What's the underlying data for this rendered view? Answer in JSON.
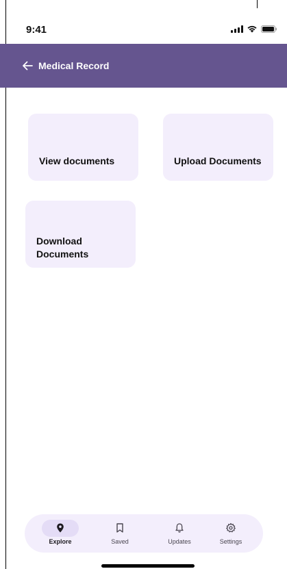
{
  "status_bar": {
    "time": "9:41"
  },
  "app_bar": {
    "title": "Medical Record"
  },
  "cards": [
    {
      "label": "View documents"
    },
    {
      "label": "Upload Documents"
    },
    {
      "label": "Download Documents"
    }
  ],
  "nav": [
    {
      "label": "Explore",
      "icon": "location-pin-icon",
      "active": true
    },
    {
      "label": "Saved",
      "icon": "bookmark-icon",
      "active": false
    },
    {
      "label": "Updates",
      "icon": "bell-icon",
      "active": false
    },
    {
      "label": "Settings",
      "icon": "gear-icon",
      "active": false
    }
  ],
  "colors": {
    "app_bar": "#65558f",
    "card": "#f3eefc",
    "nav_pill": "#e4dcf6"
  }
}
